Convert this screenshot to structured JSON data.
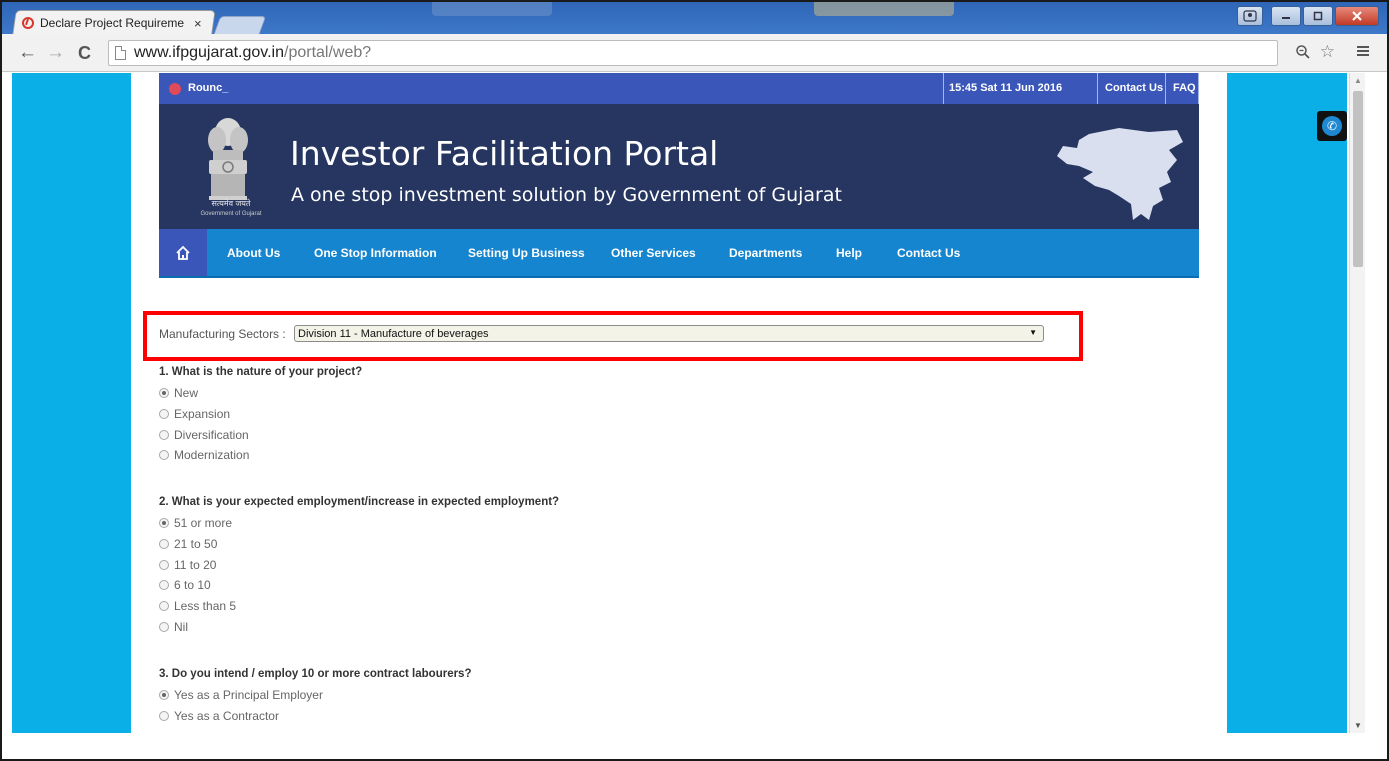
{
  "browser": {
    "tab_title": "Declare Project Requireme",
    "tab_close": "×",
    "url_domain": "www.ifpgujarat.gov.in",
    "url_path": "/portal/web?",
    "back": "←",
    "forward": "→",
    "reload": "C",
    "zoom_icon": "zoom-icon",
    "star_icon": "star-icon",
    "menu_icon": "menu-icon"
  },
  "topbar": {
    "round_text": "Rounc_",
    "datetime": "15:45  Sat  11 Jun 2016",
    "contact": "Contact Us",
    "faq": "FAQ"
  },
  "banner": {
    "title": "Investor Facilitation Portal",
    "subtitle": "A one stop investment solution by Government of Gujarat",
    "emblem_caption": "सत्यमेव जयते",
    "emblem_subcaption": "Government of Gujarat"
  },
  "nav": {
    "home_icon": "home-icon",
    "items": [
      "About Us",
      "One Stop Information",
      "Setting Up Business",
      "Other Services",
      "Departments",
      "Help",
      "Contact Us"
    ]
  },
  "form": {
    "sector_label": "Manufacturing Sectors :",
    "sector_value": "Division 11 - Manufacture of beverages",
    "questions": [
      {
        "title": "1. What is the nature of your project?",
        "options": [
          "New",
          "Expansion",
          "Diversification",
          "Modernization"
        ],
        "selected": 0
      },
      {
        "title": "2. What is your expected employment/increase in expected employment?",
        "options": [
          "51 or more",
          "21 to 50",
          "11 to 20",
          "6 to 10",
          "Less than 5",
          "Nil"
        ],
        "selected": 0
      },
      {
        "title": "3. Do you intend / employ 10 or more contract labourers?",
        "options": [
          "Yes as a Principal Employer",
          "Yes as a Contractor"
        ],
        "selected": 0
      }
    ]
  },
  "colors": {
    "page_bg": "#0bafe7",
    "topbar": "#3a56b9",
    "banner": "#263660",
    "nav": "#1685cf",
    "highlight": "#ff0000"
  }
}
